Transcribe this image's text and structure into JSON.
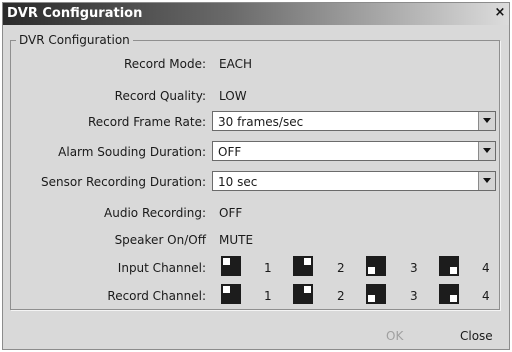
{
  "window": {
    "title": "DVR Configuration",
    "close_glyph": "×"
  },
  "group": {
    "legend": "DVR Configuration"
  },
  "fields": {
    "record_mode": {
      "label": "Record Mode:",
      "value": "EACH"
    },
    "record_quality": {
      "label": "Record Quality:",
      "value": "LOW"
    },
    "frame_rate": {
      "label": "Record Frame Rate:",
      "value": "30 frames/sec"
    },
    "alarm_duration": {
      "label": "Alarm Souding Duration:",
      "value": "OFF"
    },
    "sensor_duration": {
      "label": "Sensor Recording Duration:",
      "value": "10 sec"
    },
    "audio_recording": {
      "label": "Audio Recording:",
      "value": "OFF"
    },
    "speaker": {
      "label": "Speaker On/Off",
      "value": "MUTE"
    }
  },
  "input_channel": {
    "label": "Input Channel:",
    "channels": [
      "1",
      "2",
      "3",
      "4"
    ]
  },
  "record_channel": {
    "label": "Record Channel:",
    "channels": [
      "1",
      "2",
      "3",
      "4"
    ]
  },
  "buttons": {
    "ok": "OK",
    "close": "Close"
  }
}
